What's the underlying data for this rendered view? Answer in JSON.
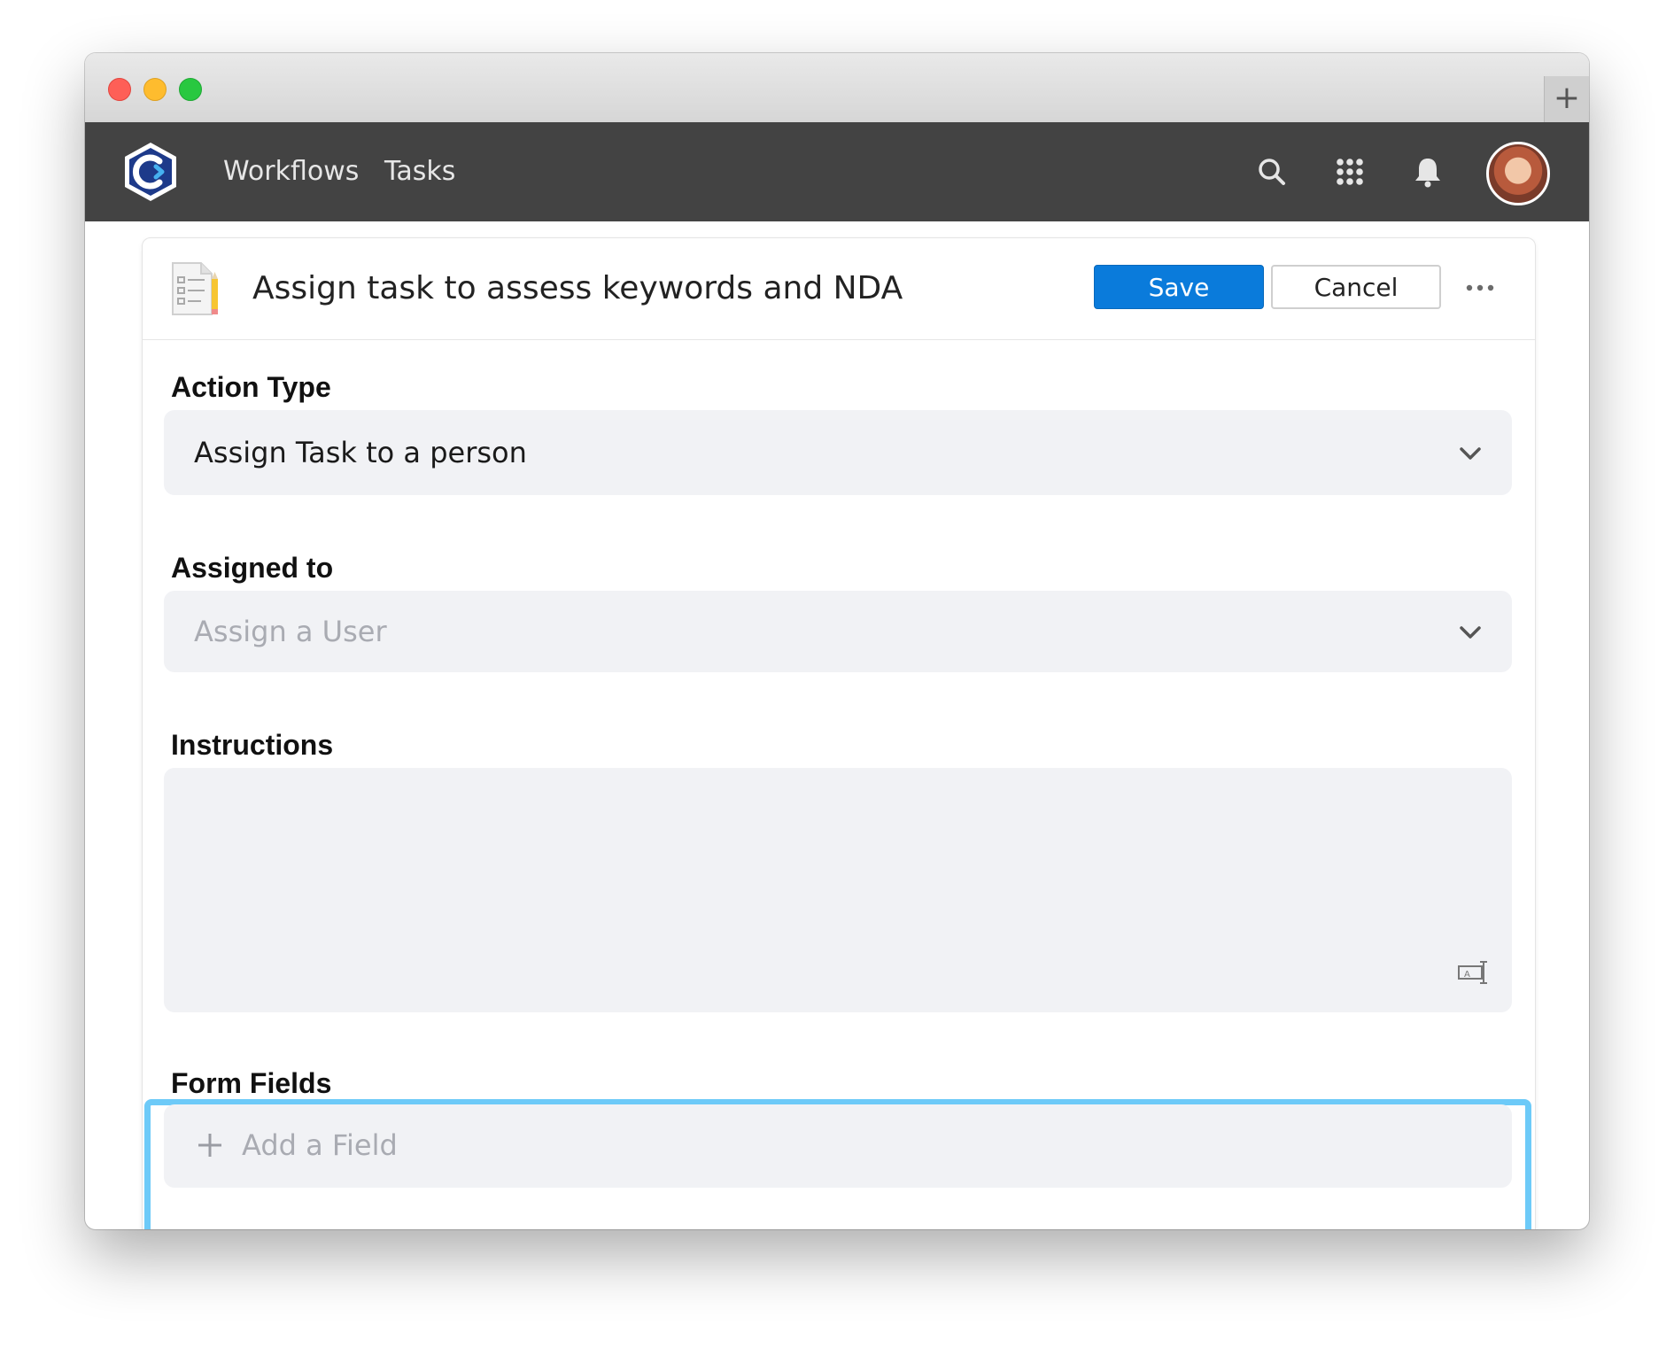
{
  "navbar": {
    "links": [
      "Workflows",
      "Tasks"
    ]
  },
  "editor": {
    "title": "Assign task to assess keywords and NDA",
    "save_label": "Save",
    "cancel_label": "Cancel"
  },
  "form": {
    "action_type": {
      "label": "Action Type",
      "value": "Assign Task to a person"
    },
    "assigned_to": {
      "label": "Assigned to",
      "placeholder": "Assign a User"
    },
    "instructions": {
      "label": "Instructions",
      "value": ""
    },
    "form_fields": {
      "label": "Form Fields",
      "add_label": "Add a Field"
    }
  },
  "colors": {
    "accent": "#0a7bdb",
    "navbar": "#434343",
    "highlight": "#6dcaf8"
  },
  "icons": [
    "search-icon",
    "apps-grid-icon",
    "bell-icon",
    "more-icon",
    "chevron-down-icon",
    "plus-icon",
    "resize-text-icon"
  ]
}
